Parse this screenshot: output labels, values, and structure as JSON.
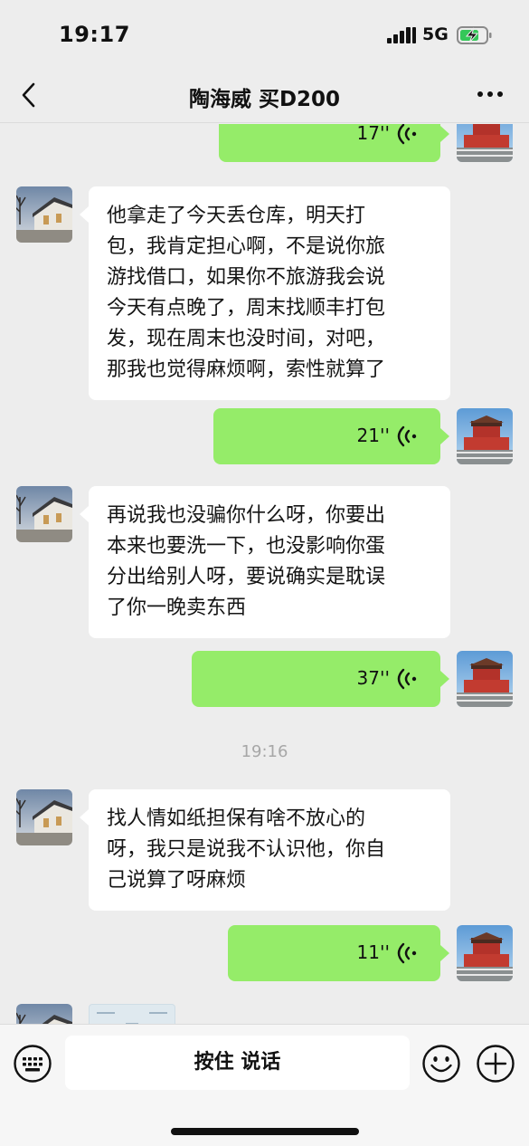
{
  "status_bar": {
    "time": "19:17",
    "network": "5G",
    "battery_state": "charging",
    "signal_icon": "signal-bars-icon",
    "battery_icon": "battery-charging-icon"
  },
  "nav": {
    "back_icon": "chevron-left-icon",
    "title": "陶海威 买D200",
    "more_icon": "more-dots-icon"
  },
  "messages": [
    {
      "type": "voice",
      "direction": "out",
      "duration": "17''"
    },
    {
      "type": "text",
      "direction": "in",
      "lines": [
        "他拿走了今天丢仓库，明天打",
        "包，我肯定担心啊，不是说你旅",
        "游找借口，如果你不旅游我会说",
        "今天有点晚了，周末找顺丰打包",
        "发，现在周末也没时间，对吧，",
        "那我也觉得麻烦啊，索性就算了"
      ]
    },
    {
      "type": "voice",
      "direction": "out",
      "duration": "21''"
    },
    {
      "type": "text",
      "direction": "in",
      "lines": [
        "再说我也没骗你什么呀，你要出",
        "本来也要洗一下，也没影响你蛋",
        "分出给别人呀，要说确实是耽误",
        "了你一晚卖东西"
      ]
    },
    {
      "type": "voice",
      "direction": "out",
      "duration": "37''"
    },
    {
      "type": "time",
      "text": "19:16"
    },
    {
      "type": "text",
      "direction": "in",
      "lines": [
        "找人情如纸担保有啥不放心的",
        "呀，我只是说我不认识他，你自",
        "己说算了呀麻烦"
      ]
    },
    {
      "type": "voice",
      "direction": "out",
      "duration": "11''"
    },
    {
      "type": "image",
      "direction": "in"
    }
  ],
  "input_bar": {
    "keyboard_icon": "keyboard-icon",
    "hold_to_talk_label": "按住 说话",
    "emoji_icon": "emoji-icon",
    "plus_icon": "plus-icon"
  },
  "colors": {
    "background": "#ededed",
    "out_bubble": "#95ec69",
    "in_bubble": "#ffffff",
    "battery_fill": "#34c759"
  }
}
